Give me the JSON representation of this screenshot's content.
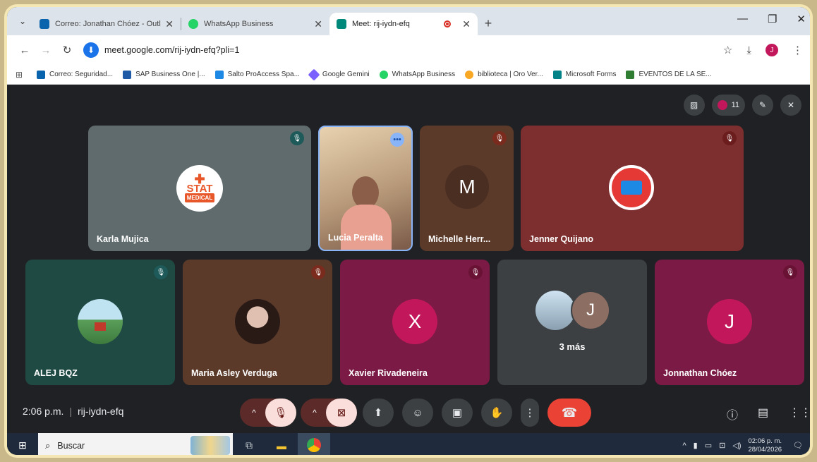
{
  "browser": {
    "tabs": [
      {
        "label": "Correo: Jonathan Chóez - Outl",
        "favicon_color": "#0a64ad",
        "active": false
      },
      {
        "label": "WhatsApp Business",
        "favicon_color": "#25d366",
        "active": false
      },
      {
        "label": "Meet: rij-iydn-efq",
        "favicon_color": "#00897b",
        "active": true
      }
    ],
    "tab_close_glyph": "✕",
    "new_tab_glyph": "+",
    "url": "meet.google.com/rij-iydn-efq?pli=1",
    "profile_initial": "J",
    "bookmarks": [
      {
        "label": "Correo: Seguridad...",
        "color": "#0a64ad"
      },
      {
        "label": "SAP Business One |...",
        "color": "#1f5aa6"
      },
      {
        "label": "Salto ProAccess Spa...",
        "color": "#1e88e5"
      },
      {
        "label": "Google Gemini",
        "color": "#7b61ff"
      },
      {
        "label": "WhatsApp Business",
        "color": "#25d366"
      },
      {
        "label": "biblioteca | Oro Ver...",
        "color": "#f9a825"
      },
      {
        "label": "Microsoft Forms",
        "color": "#038387"
      },
      {
        "label": "EVENTOS DE LA SE...",
        "color": "#2e7d32"
      }
    ]
  },
  "meet": {
    "participants_count": "11",
    "tiles": [
      {
        "name": "Karla Mujica",
        "bg": "#5f6b6d",
        "avatar_text": "STAT\nMEDICAL",
        "mute_bg": "#1e5a5a"
      },
      {
        "name": "Lucia Peralta",
        "bg": "#b89a7a",
        "avatar_text": "",
        "mute_bg": "#8ab4f8"
      },
      {
        "name": "Michelle Herr...",
        "bg": "#5b3a2a",
        "avatar_text": "M",
        "mute_bg": "#7a2b1d"
      },
      {
        "name": "Jenner Quijano",
        "bg": "#7d2e2e",
        "avatar_text": "",
        "mute_bg": "#6b1d1d"
      },
      {
        "name": "ALEJ BQZ",
        "bg": "#1f4a44",
        "avatar_text": "",
        "mute_bg": "#1e5a5a"
      },
      {
        "name": "Maria Asley Verduga",
        "bg": "#5b3a2a",
        "avatar_text": "",
        "mute_bg": "#7a2b1d"
      },
      {
        "name": "Xavier Rivadeneira",
        "bg": "#7a1a45",
        "avatar_text": "X",
        "mute_bg": "#6a1234"
      },
      {
        "name": "",
        "bg": "#3c4043",
        "avatar_text": "J",
        "more_label": "3 más"
      },
      {
        "name": "Jonnathan Chóez",
        "bg": "#7a1a45",
        "avatar_text": "J",
        "mute_bg": "#6a1234"
      }
    ],
    "time": "2:06 p.m.",
    "meeting_code": "rij-iydn-efq"
  },
  "taskbar": {
    "search_placeholder": "Buscar",
    "clock_time": "02:06 p. m.",
    "clock_date": "28/04/2026"
  }
}
